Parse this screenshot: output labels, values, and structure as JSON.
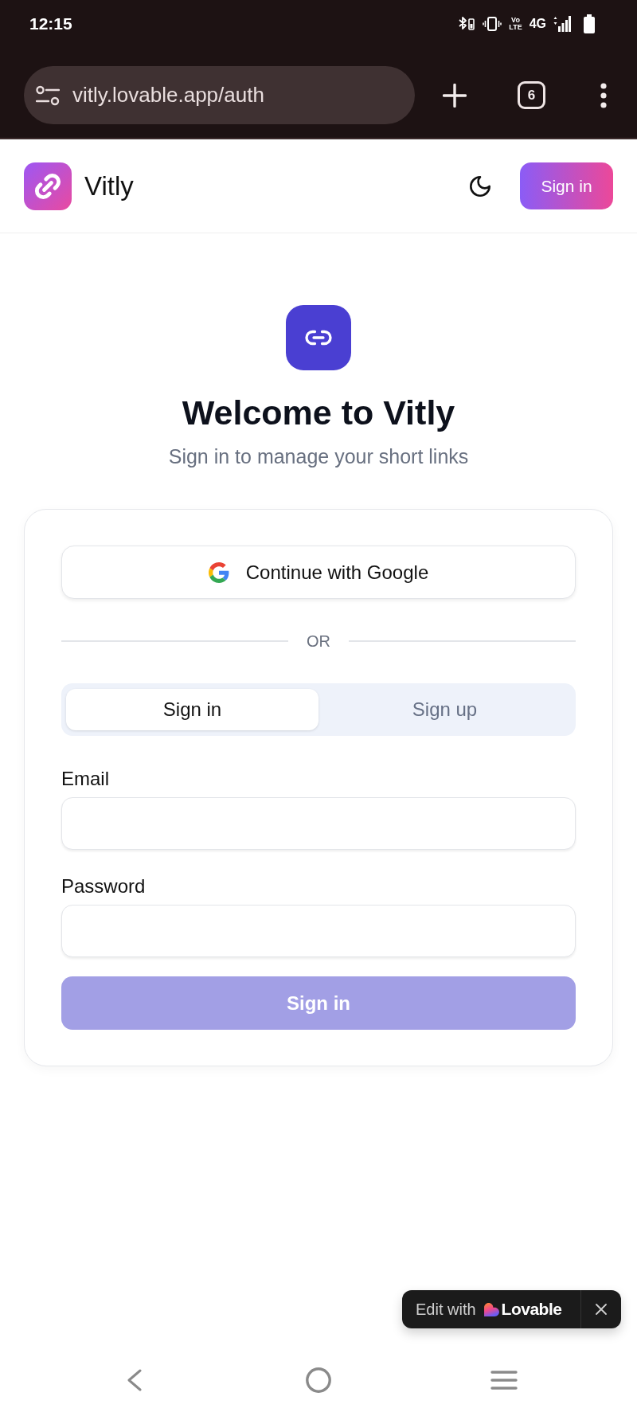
{
  "status_bar": {
    "time": "12:15",
    "volte": {
      "top": "Vo",
      "bottom": "LTE"
    },
    "network": "4G"
  },
  "browser": {
    "url": "vitly.lovable.app/auth",
    "tab_count": "6"
  },
  "header": {
    "brand": "Vitly",
    "sign_in_button": "Sign in"
  },
  "hero": {
    "title": "Welcome to Vitly",
    "subtitle": "Sign in to manage your short links"
  },
  "auth_card": {
    "google_button": "Continue with Google",
    "divider": "OR",
    "tabs": [
      {
        "label": "Sign in",
        "selected": true
      },
      {
        "label": "Sign up",
        "selected": false
      }
    ],
    "fields": [
      {
        "label": "Email"
      },
      {
        "label": "Password"
      }
    ],
    "submit": {
      "label": "Sign in",
      "disabled": true
    }
  },
  "badge": {
    "prefix": "Edit with",
    "brand": "Lovable"
  }
}
